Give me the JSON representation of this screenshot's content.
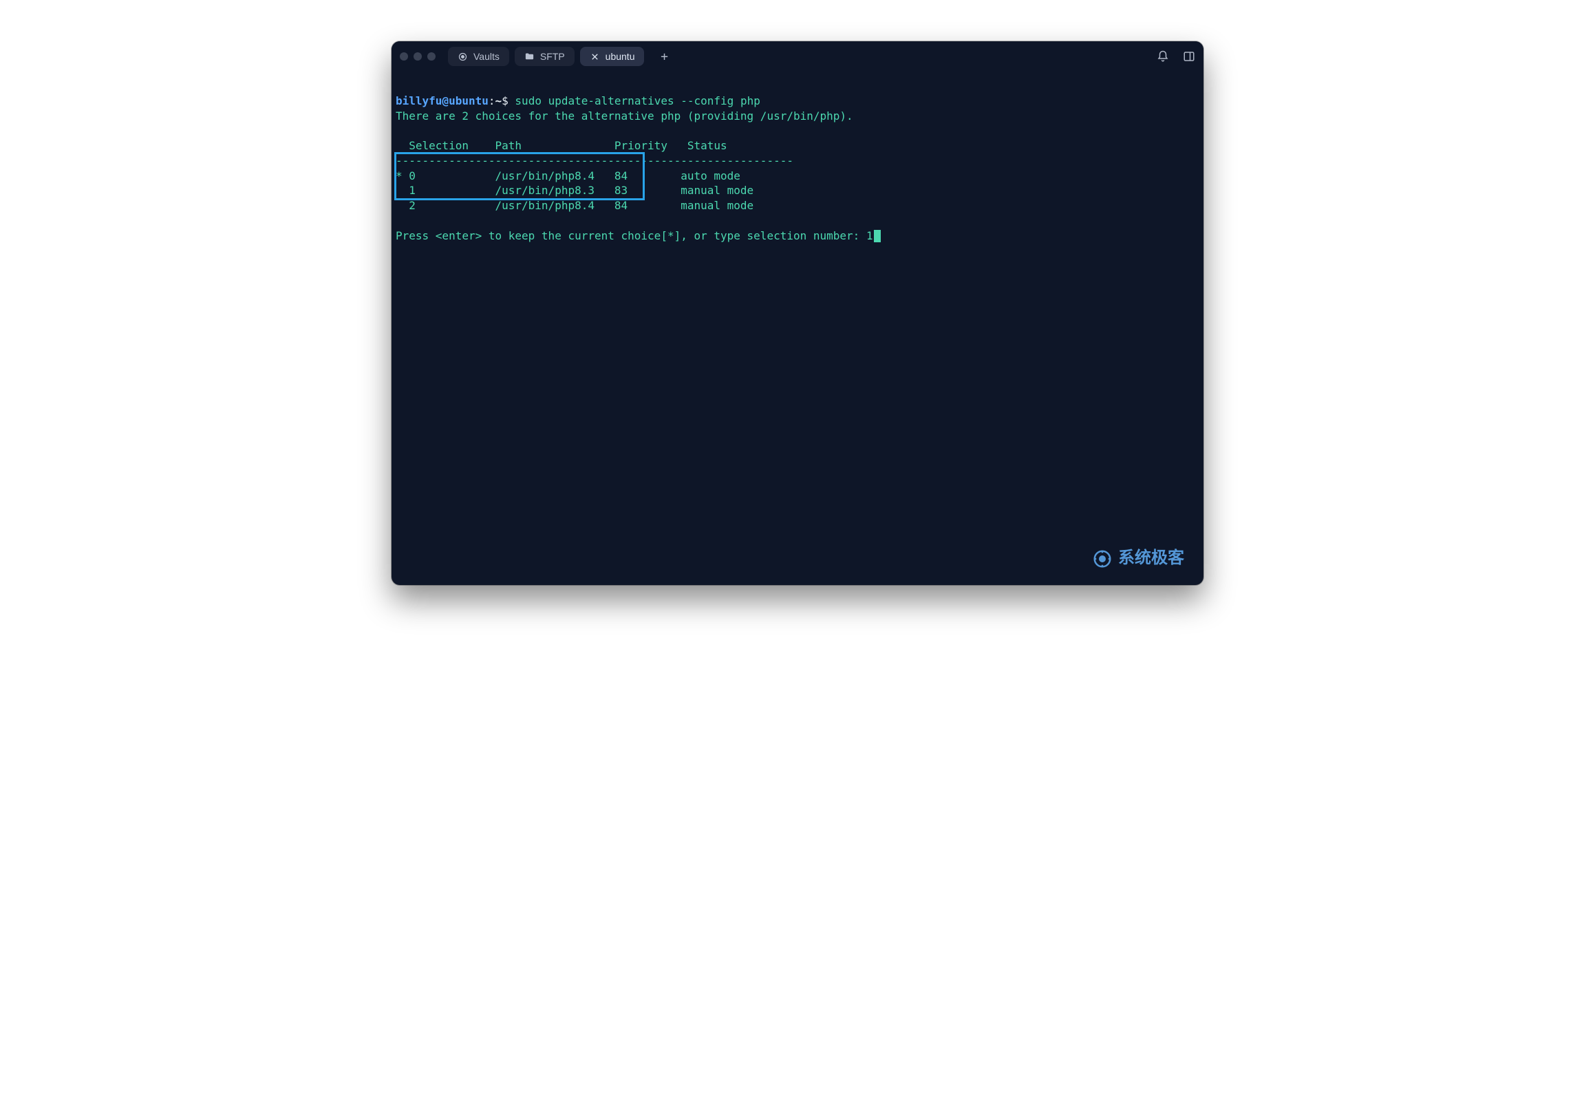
{
  "tabs": {
    "vaults": "Vaults",
    "sftp": "SFTP",
    "ubuntu": "ubuntu"
  },
  "prompt": {
    "userhost": "billyfu@ubuntu",
    "colon": ":",
    "path": "~",
    "symbol": "$"
  },
  "command": "sudo update-alternatives --config php",
  "output": {
    "intro": "There are 2 choices for the alternative php (providing /usr/bin/php).",
    "header": "  Selection    Path              Priority   Status",
    "divider": "------------------------------------------------------------",
    "rows": [
      "* 0            /usr/bin/php8.4   84        auto mode",
      "  1            /usr/bin/php8.3   83        manual mode",
      "  2            /usr/bin/php8.4   84        manual mode"
    ],
    "prompt_line": "Press <enter> to keep the current choice[*], or type selection number: ",
    "typed": "1"
  },
  "alternatives": [
    {
      "selection": 0,
      "path": "/usr/bin/php8.4",
      "priority": 84,
      "status": "auto mode",
      "current": true
    },
    {
      "selection": 1,
      "path": "/usr/bin/php8.3",
      "priority": 83,
      "status": "manual mode",
      "current": false
    },
    {
      "selection": 2,
      "path": "/usr/bin/php8.4",
      "priority": 84,
      "status": "manual mode",
      "current": false
    }
  ],
  "watermark": "系统极客",
  "newtab_glyph": "+"
}
